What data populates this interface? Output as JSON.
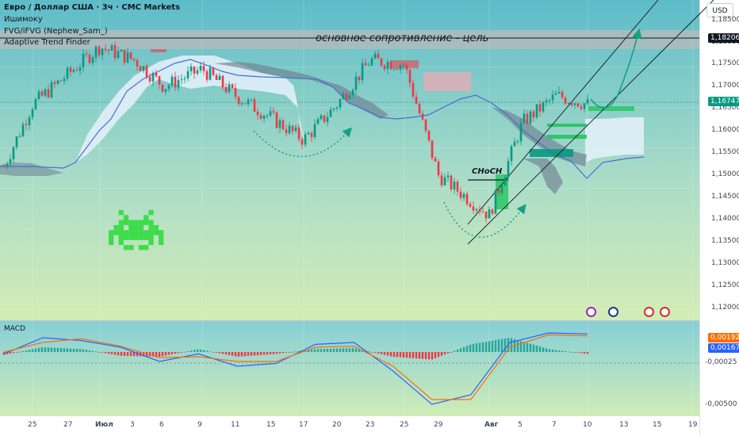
{
  "legend": {
    "symbol_line": "Евро / Доллар США · 3ч · CMC Markets",
    "indicator_1": "Ишимоку",
    "indicator_2": "FVG/iFVG (Nephew_Sam_)",
    "indicator_3": "Adaptive Trend Finder"
  },
  "currency_button": "USD",
  "annotations": {
    "resistance": "основное сопротивление - цель",
    "choch": "CHoCH"
  },
  "macd_label": "MACD",
  "colors": {
    "bull_candle": "#089981",
    "bear_candle": "#f23645",
    "cloud_fill": "#cfe5f7",
    "cloud_dark": "#708090",
    "trend_line": "#4a6cd4",
    "fvg_green": "#22c55e",
    "fvg_red": "#f4a6b1",
    "arrow": "#16a085",
    "macd_line": "#2962ff",
    "signal_line": "#ff6d00",
    "current_price_badge": "#089981",
    "resistance_zone": "#b9b9b9"
  },
  "chart_data": [
    {
      "type": "line",
      "title": "Евро / Доллар США · 3ч · CMC Markets",
      "ylabel": "USD",
      "ylim": [
        1.118,
        1.186
      ],
      "y_ticks": [
        "1,18500",
        "1,18000",
        "1,17500",
        "1,17000",
        "1,16500",
        "1,16000",
        "1,15500",
        "1,15000",
        "1,14500",
        "1,14000",
        "1,13500",
        "1,13000",
        "1,12500",
        "1,12000"
      ],
      "x_ticks": [
        "25",
        "27",
        "Июл",
        "3",
        "6",
        "9",
        "11",
        "15",
        "17",
        "20",
        "23",
        "25",
        "29",
        "Авг",
        "5",
        "7",
        "10",
        "13",
        "15",
        "19"
      ],
      "current_price": "1,16747",
      "resistance_level": "1,18206",
      "close_path": {
        "x": [
          "25",
          "27",
          "Июл",
          "3",
          "6",
          "9",
          "11",
          "15",
          "17",
          "20",
          "23",
          "25",
          "29",
          "Авг",
          "5",
          "7",
          "10"
        ],
        "y": [
          1.152,
          1.166,
          1.179,
          1.176,
          1.17,
          1.174,
          1.168,
          1.163,
          1.158,
          1.166,
          1.176,
          1.175,
          1.15,
          1.141,
          1.162,
          1.168,
          1.166
        ]
      },
      "grid": true,
      "legend_position": "top-left"
    },
    {
      "type": "line",
      "title": "MACD",
      "ylim": [
        -0.0065,
        0.003
      ],
      "y_ticks": [
        "-0,00500"
      ],
      "macd_value": "0,00192",
      "signal_value": "0,00167",
      "histogram_value": "-0,00025",
      "series": [
        {
          "name": "MACD",
          "values": [
            -0.0002,
            0.0015,
            0.0012,
            0.0005,
            -0.001,
            -0.0002,
            -0.0015,
            -0.0012,
            0.0008,
            0.001,
            -0.002,
            -0.0055,
            -0.0045,
            0.001,
            0.002,
            0.0019
          ]
        },
        {
          "name": "Signal",
          "values": [
            0.0,
            0.001,
            0.0014,
            0.0006,
            -0.0006,
            -0.0005,
            -0.001,
            -0.001,
            0.0005,
            0.0006,
            -0.0015,
            -0.005,
            -0.005,
            0.0005,
            0.0018,
            0.0017
          ]
        }
      ],
      "histogram": [
        -0.0003,
        0.0005,
        0.0003,
        -0.0004,
        -0.0005,
        0.0003,
        -0.0005,
        -0.0002,
        0.0003,
        0.0004,
        -0.0005,
        -0.0008,
        0.0008,
        0.0015,
        0.0003,
        -0.0002
      ]
    }
  ]
}
